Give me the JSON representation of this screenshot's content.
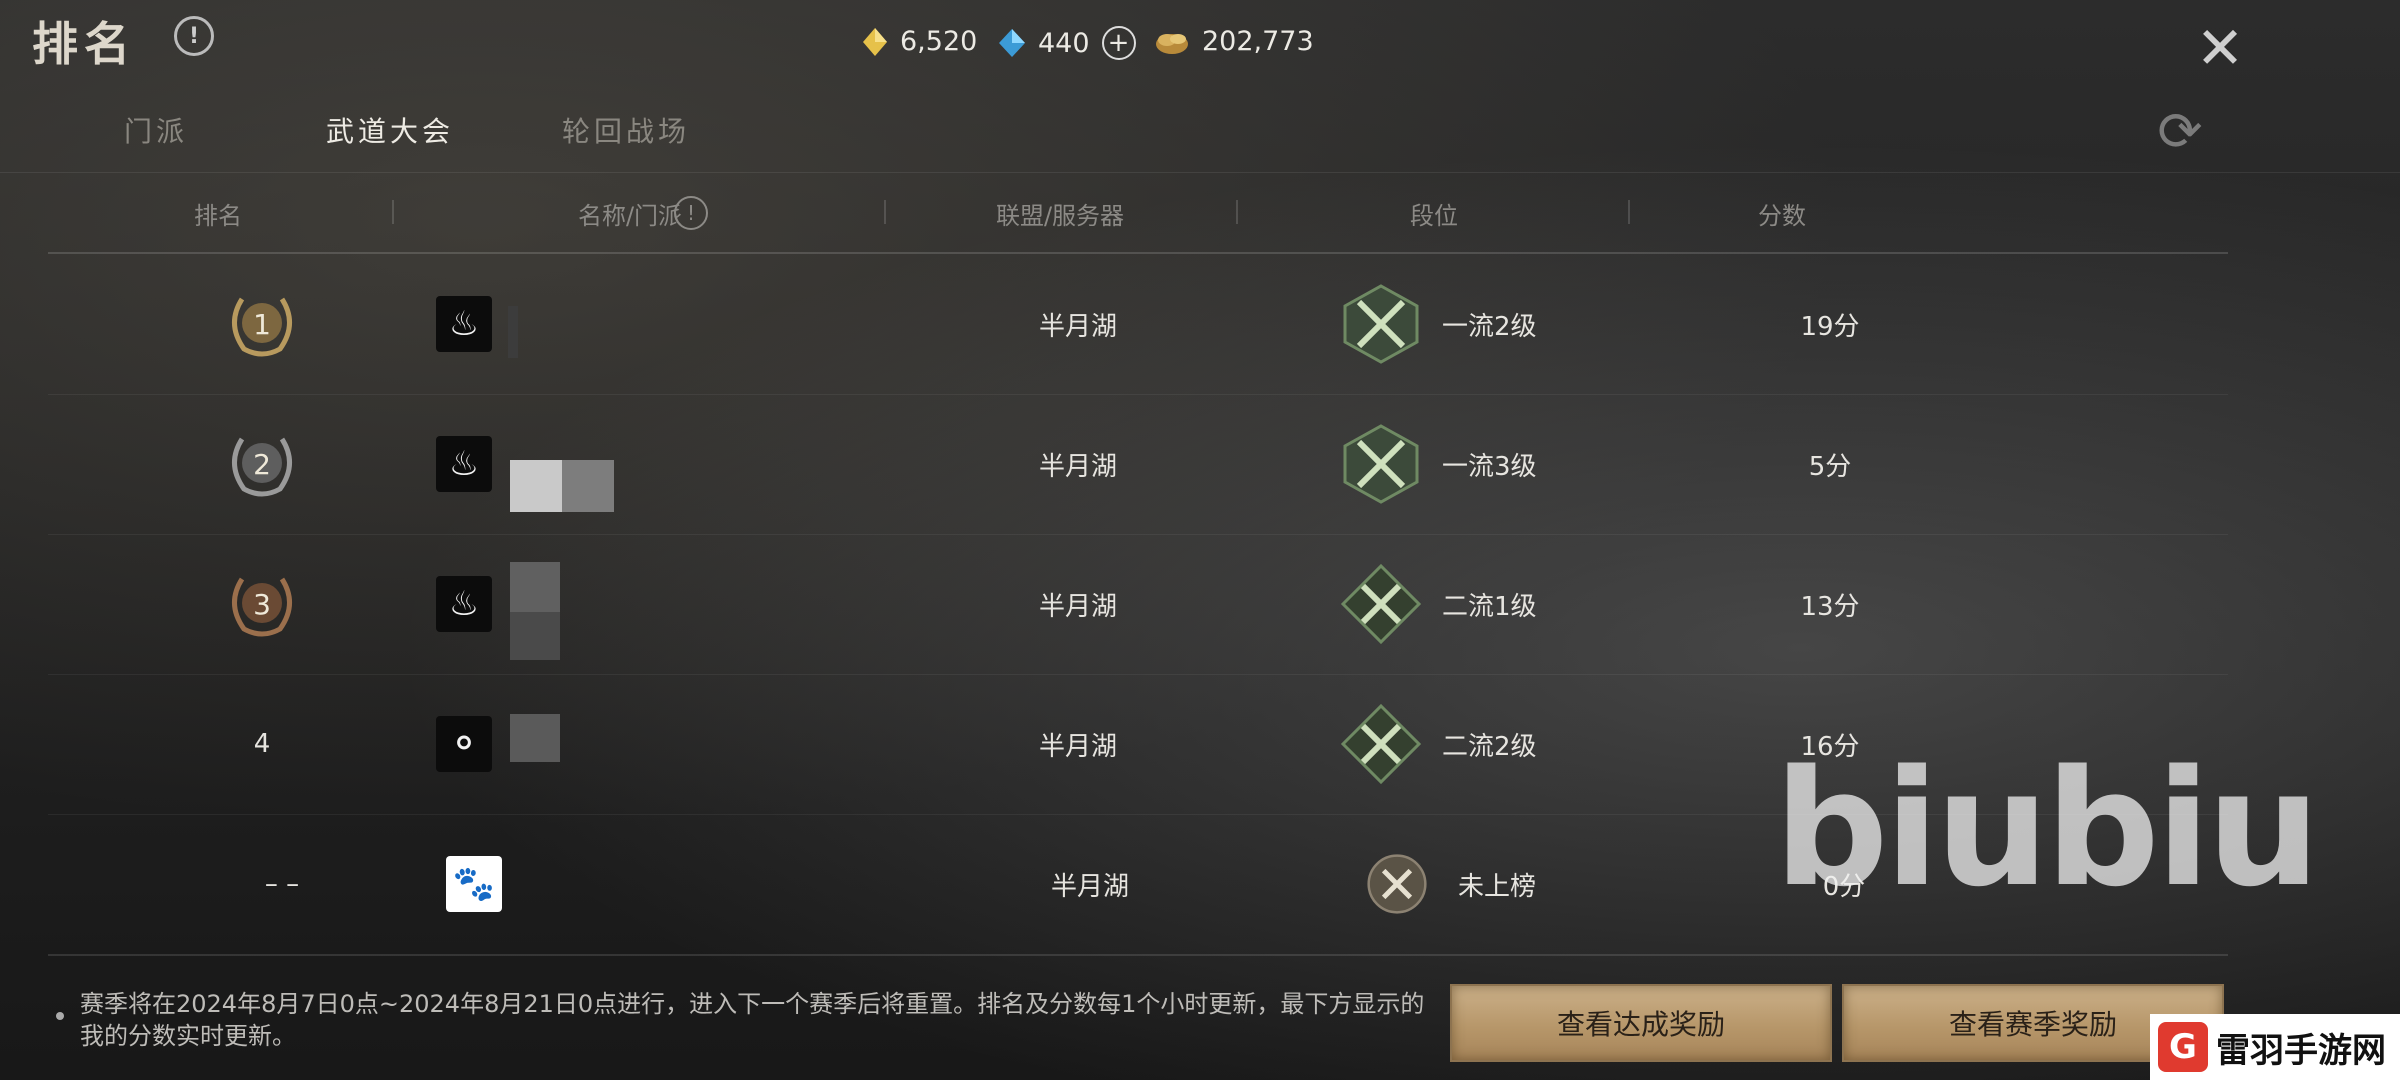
{
  "header": {
    "title": "排名",
    "close_icon": "close-icon",
    "refresh_icon": "refresh-icon"
  },
  "currencies": [
    {
      "icon": "gold-ingot-icon",
      "value": "6,520",
      "color": "#e6c14a"
    },
    {
      "icon": "blue-crystal-icon",
      "value": "440",
      "color": "#56b6e8",
      "add": "+"
    },
    {
      "icon": "copper-coin-icon",
      "value": "202,773",
      "color": "#c9a24f"
    }
  ],
  "tabs": [
    {
      "label": "门派",
      "active": false
    },
    {
      "label": "武道大会",
      "active": true
    },
    {
      "label": "轮回战场",
      "active": false
    }
  ],
  "columns": {
    "rank": "排名",
    "name": "名称/门派",
    "server": "联盟/服务器",
    "tier": "段位",
    "score": "分数"
  },
  "rows": [
    {
      "rank": "1",
      "server": "半月湖",
      "tier": "一流2级",
      "score": "19分"
    },
    {
      "rank": "2",
      "server": "半月湖",
      "tier": "一流3级",
      "score": "5分"
    },
    {
      "rank": "3",
      "server": "半月湖",
      "tier": "二流1级",
      "score": "13分"
    },
    {
      "rank": "4",
      "server": "半月湖",
      "tier": "二流2级",
      "score": "16分"
    },
    {
      "rank": "–    –",
      "server": "半月湖",
      "tier": "未上榜",
      "score": "0分"
    }
  ],
  "footer": {
    "note": "赛季将在2024年8月7日0点~2024年8月21日0点进行，进入下一个赛季后将重置。排名及分数每1个小时更新，最下方显示的我的分数实时更新。",
    "achievement_button": "查看达成奖励",
    "season_button": "查看赛季奖励"
  },
  "watermark": "biubiu",
  "site_logo": {
    "mark": "G",
    "text": "雷羽手游网"
  }
}
